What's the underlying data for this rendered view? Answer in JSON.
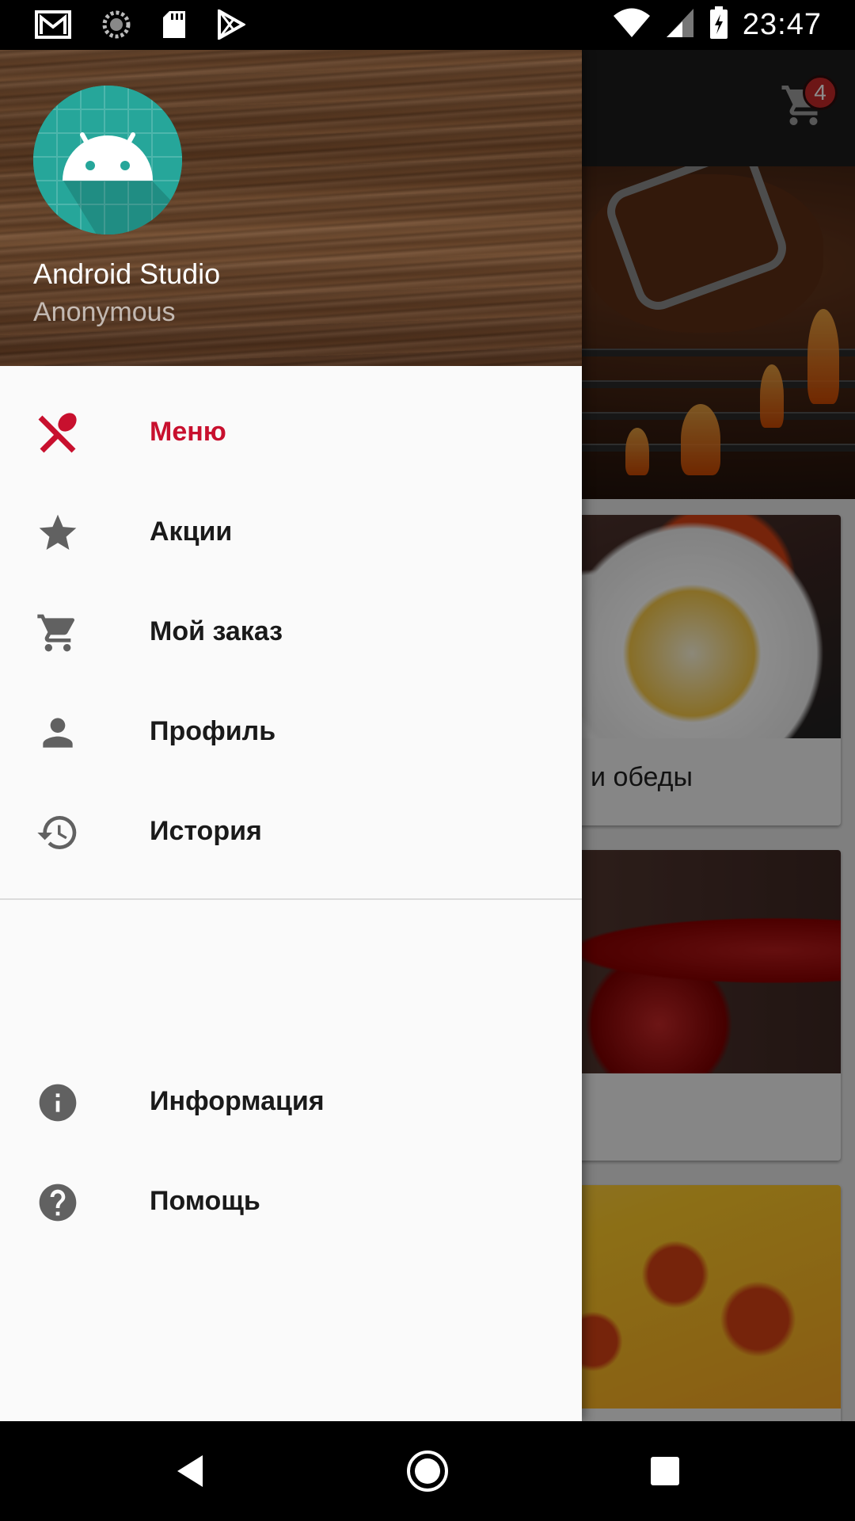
{
  "status_bar": {
    "time": "23:47",
    "left_icons": [
      "gmail-icon",
      "sync-icon",
      "sd-card-icon",
      "play-store-icon"
    ],
    "right_icons": [
      "wifi-icon",
      "signal-icon",
      "battery-charging-icon"
    ]
  },
  "toolbar": {
    "cart_count": "4",
    "cart_icon": "shopping-cart-icon"
  },
  "content": {
    "cards": [
      {
        "caption": "и обеды"
      },
      {
        "caption": ""
      },
      {
        "caption": ""
      }
    ]
  },
  "drawer": {
    "header": {
      "name": "Android Studio",
      "subtitle": "Anonymous"
    },
    "items": [
      {
        "label": "Меню",
        "icon": "fork-spoon-icon",
        "active": true
      },
      {
        "label": "Акции",
        "icon": "star-icon"
      },
      {
        "label": "Мой заказ",
        "icon": "cart-icon"
      },
      {
        "label": "Профиль",
        "icon": "person-icon"
      },
      {
        "label": "История",
        "icon": "history-icon"
      }
    ],
    "secondary_items": [
      {
        "label": "Информация",
        "icon": "info-icon"
      },
      {
        "label": "Помощь",
        "icon": "help-icon"
      }
    ]
  },
  "colors": {
    "accent": "#c8102e",
    "badge": "#c62828",
    "avatar_bg": "#26a69a",
    "drawer_bg": "#fafafa",
    "icon_grey": "#616161"
  },
  "system_nav": {
    "buttons": [
      "back-icon",
      "home-icon",
      "recents-icon"
    ]
  }
}
